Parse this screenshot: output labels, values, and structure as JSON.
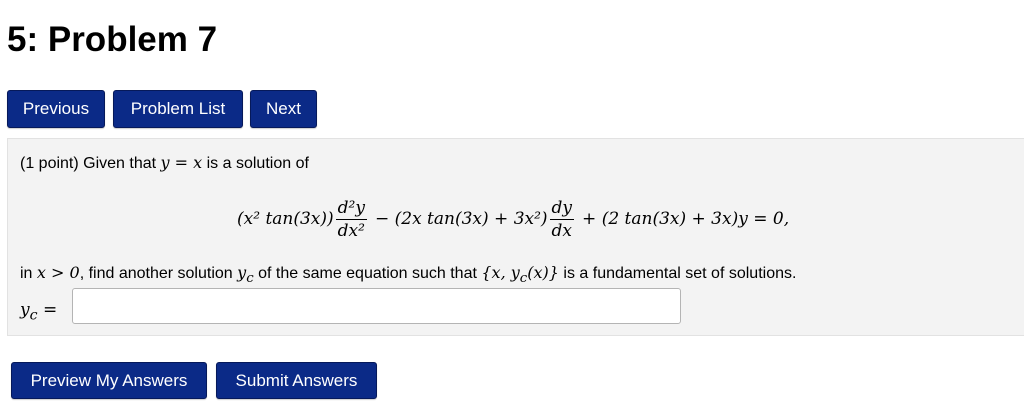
{
  "page": {
    "title": "5: Problem 7"
  },
  "nav": {
    "previous_label": "Previous",
    "problem_list_label": "Problem List",
    "next_label": "Next"
  },
  "problem": {
    "intro_prefix": "(1 point) Given that",
    "intro_math": "y = x",
    "intro_suffix": "is a solution of",
    "equation": {
      "term1_prefix": "(x² tan(3x))",
      "term1_num": "d²y",
      "term1_den": "dx²",
      "term2_prefix": "− (2x tan(3x) + 3x²)",
      "term2_num": "dy",
      "term2_den": "dx",
      "term3": "+ (2 tan(3x) + 3x)y = 0,"
    },
    "statement_in": "in",
    "statement_cond": "x > 0",
    "statement_mid": ", find another solution",
    "statement_var": "y",
    "statement_sub": "c",
    "statement_mid2": "of the same equation such that",
    "statement_set": "{x, y",
    "statement_set_sub": "c",
    "statement_set_end": "(x)}",
    "statement_end": "is a fundamental set of solutions.",
    "answer_var": "y",
    "answer_sub": "c",
    "answer_eq": "=",
    "answer_value": "",
    "answer_placeholder": ""
  },
  "actions": {
    "preview_label": "Preview My Answers",
    "submit_label": "Submit Answers"
  },
  "colors": {
    "button_bg": "#0b2a87",
    "panel_bg": "#f3f3f3"
  }
}
